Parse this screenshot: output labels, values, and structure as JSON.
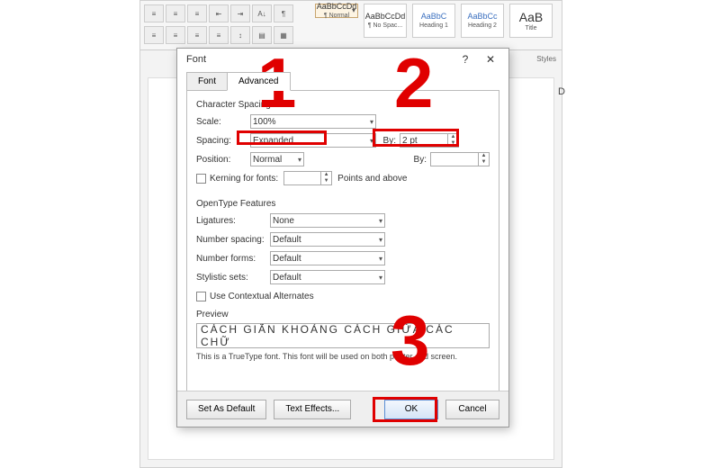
{
  "ribbon": {
    "styles": [
      {
        "sample": "AaBbCcDd",
        "label": "¶ Normal",
        "selected": true
      },
      {
        "sample": "AaBbCcDd",
        "label": "¶ No Spac..."
      },
      {
        "sample": "AaBbC",
        "label": "Heading 1"
      },
      {
        "sample": "AaBbCc",
        "label": "Heading 2"
      },
      {
        "sample": "AaB",
        "label": "Title",
        "big": true
      }
    ],
    "styles_header": "Styles"
  },
  "doc_sample_right": "D",
  "dialog": {
    "title": "Font",
    "help": "?",
    "close": "✕",
    "tabs": {
      "font": "Font",
      "advanced": "Advanced"
    },
    "char_spacing": {
      "group": "Character Spacing",
      "scale_lbl": "Scale:",
      "scale": "100%",
      "spacing_lbl": "Spacing:",
      "spacing": "Expanded",
      "by_lbl": "By:",
      "by_val": "2 pt",
      "position_lbl": "Position:",
      "position": "Normal",
      "by2_lbl": "By:",
      "by2_val": "",
      "kerning_lbl": "Kerning for fonts:",
      "kerning_val": "",
      "kerning_suffix": "Points and above"
    },
    "opentype": {
      "group": "OpenType Features",
      "ligatures_lbl": "Ligatures:",
      "ligatures": "None",
      "numspacing_lbl": "Number spacing:",
      "numspacing": "Default",
      "numforms_lbl": "Number forms:",
      "numforms": "Default",
      "stylistic_lbl": "Stylistic sets:",
      "stylistic": "Default",
      "contextual_lbl": "Use Contextual Alternates"
    },
    "preview": {
      "label": "Preview",
      "text": "CÁCH GIÃN KHOẢNG CÁCH GIỮA CÁC CHỮ",
      "note": "This is a TrueType font. This font will be used on both printer and screen."
    },
    "footer": {
      "set_default": "Set As Default",
      "text_effects": "Text Effects...",
      "ok": "OK",
      "cancel": "Cancel"
    }
  },
  "callouts": {
    "one": "1",
    "two": "2",
    "three": "3"
  }
}
